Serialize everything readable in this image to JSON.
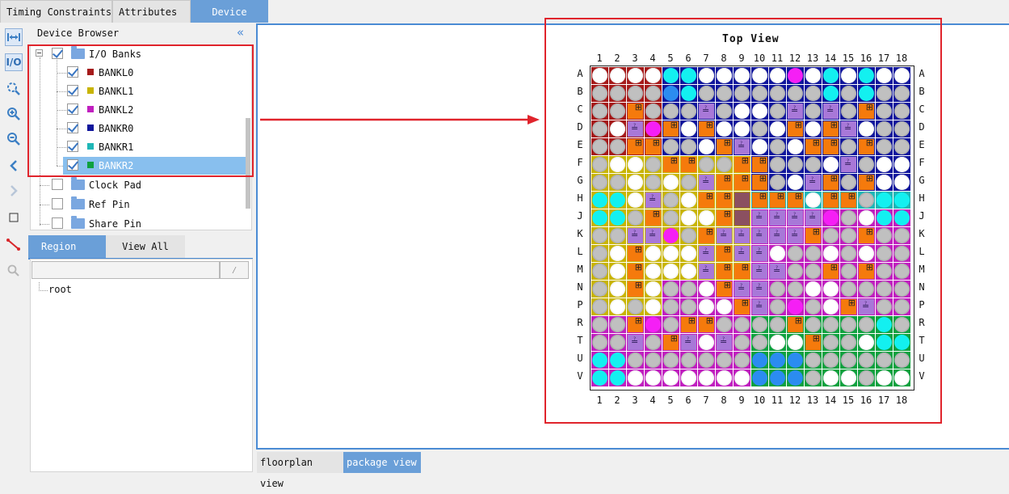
{
  "top_tabs": [
    "Timing Constraints",
    "Attributes",
    "Device"
  ],
  "toolbar_icons": [
    "fit-width-icon",
    "io-icon",
    "zoom-fit-icon",
    "zoom-in-icon",
    "zoom-out-icon",
    "back-icon",
    "forward-icon",
    "select-rect-icon",
    "route-icon",
    "search-icon"
  ],
  "device_browser": {
    "title": "Device Browser",
    "collapse_glyph": "«",
    "tree": [
      {
        "label": "I/O Banks",
        "checked": true,
        "kind": "folder"
      },
      {
        "label": "BANKL0",
        "checked": true,
        "color": "#a51a1a"
      },
      {
        "label": "BANKL1",
        "checked": true,
        "color": "#c8b400"
      },
      {
        "label": "BANKL2",
        "checked": true,
        "color": "#c01fbf"
      },
      {
        "label": "BANKR0",
        "checked": true,
        "color": "#10169c"
      },
      {
        "label": "BANKR1",
        "checked": true,
        "color": "#1fb7b7"
      },
      {
        "label": "BANKR2",
        "checked": true,
        "color": "#0fa13f",
        "selected": true
      },
      {
        "label": "Clock Pad",
        "checked": false,
        "kind": "folder"
      },
      {
        "label": "Ref Pin",
        "checked": false,
        "kind": "folder"
      },
      {
        "label": "Share Pin",
        "checked": false,
        "kind": "folder"
      }
    ]
  },
  "region_tabs": [
    "Region",
    "View All"
  ],
  "region_tree": {
    "root": "root",
    "search_button": "⁄"
  },
  "bottom_tabs": [
    "floorplan view",
    "package view"
  ],
  "package": {
    "title": "Top View",
    "cols": [
      "1",
      "2",
      "3",
      "4",
      "5",
      "6",
      "7",
      "8",
      "9",
      "10",
      "11",
      "12",
      "13",
      "14",
      "15",
      "16",
      "17",
      "18"
    ],
    "rows": [
      "A",
      "B",
      "C",
      "D",
      "E",
      "F",
      "G",
      "H",
      "J",
      "K",
      "L",
      "M",
      "N",
      "P",
      "R",
      "T",
      "U",
      "V"
    ],
    "bank_colors": {
      "L0": "#a51a1a",
      "L1": "#c8b400",
      "L2": "#c01fbf",
      "R0": "#10169c",
      "R1": "#1fb7b7",
      "R2": "#0fa13f"
    },
    "pin_colors": {
      "w": "#ffffff",
      "g": "#c0c0c0",
      "c": "#13f0f0",
      "b": "#2b8cf0",
      "m": "#f51ff5",
      "o": "#f57a0c",
      "p": "#a878d8",
      "d": "#8b5060"
    },
    "pin_marks": {
      "o": "⊞",
      "p": "≟"
    },
    "grid": [
      "L0:w w w w|R0:c c w w w|R0:w w m w c w c w w",
      "L0:g g g g|R0:b c g g g|R0:g g g g c g c g g",
      "L0:g g o g|R0:g g p g w|R0:w g p g p g o g g",
      "L0:g w p m|R0:o w o w w|R0:g w o w o p w g g",
      "L0:g g o o|R0:g g w o p|R0:w g w o o g o g g",
      "L1:g w w g|L1:o o g g o|R0:o g g g w p g w w",
      "L1:g g w g|L1:w g p o o|R0:o g w p o g o w w",
      "L1:c c w p|L1:g w o o d|R1:o o o w o o g c c",
      "L1:c c g o|L1:g w w o d|L2:p p p p m g w c c",
      "L1:g g p p|L1:m g o p p|L2:p p p o g g o g g",
      "L1:g w o w|L1:w w p o p|L2:p w g g w g w g g",
      "L1:g w o w|L1:w w p o o|L2:p p g g o g o g g",
      "L1:g w o w|L2:g g w o p|L2:p g g w w g g g g",
      "L1:g w g w|L2:g g w w o|L2:p g m g w o p g g",
      "L2:g g o m|L2:g o o g g|R2:g g o g g g g c g",
      "L2:g g p g|L2:o p w p g|R2:g w w o g g w c c",
      "L2:c c g g|L2:g g g g g|R2:b b b g g g g g g",
      "L2:c c w w|L2:w w w w w|R2:b b b g w w g w w"
    ]
  }
}
